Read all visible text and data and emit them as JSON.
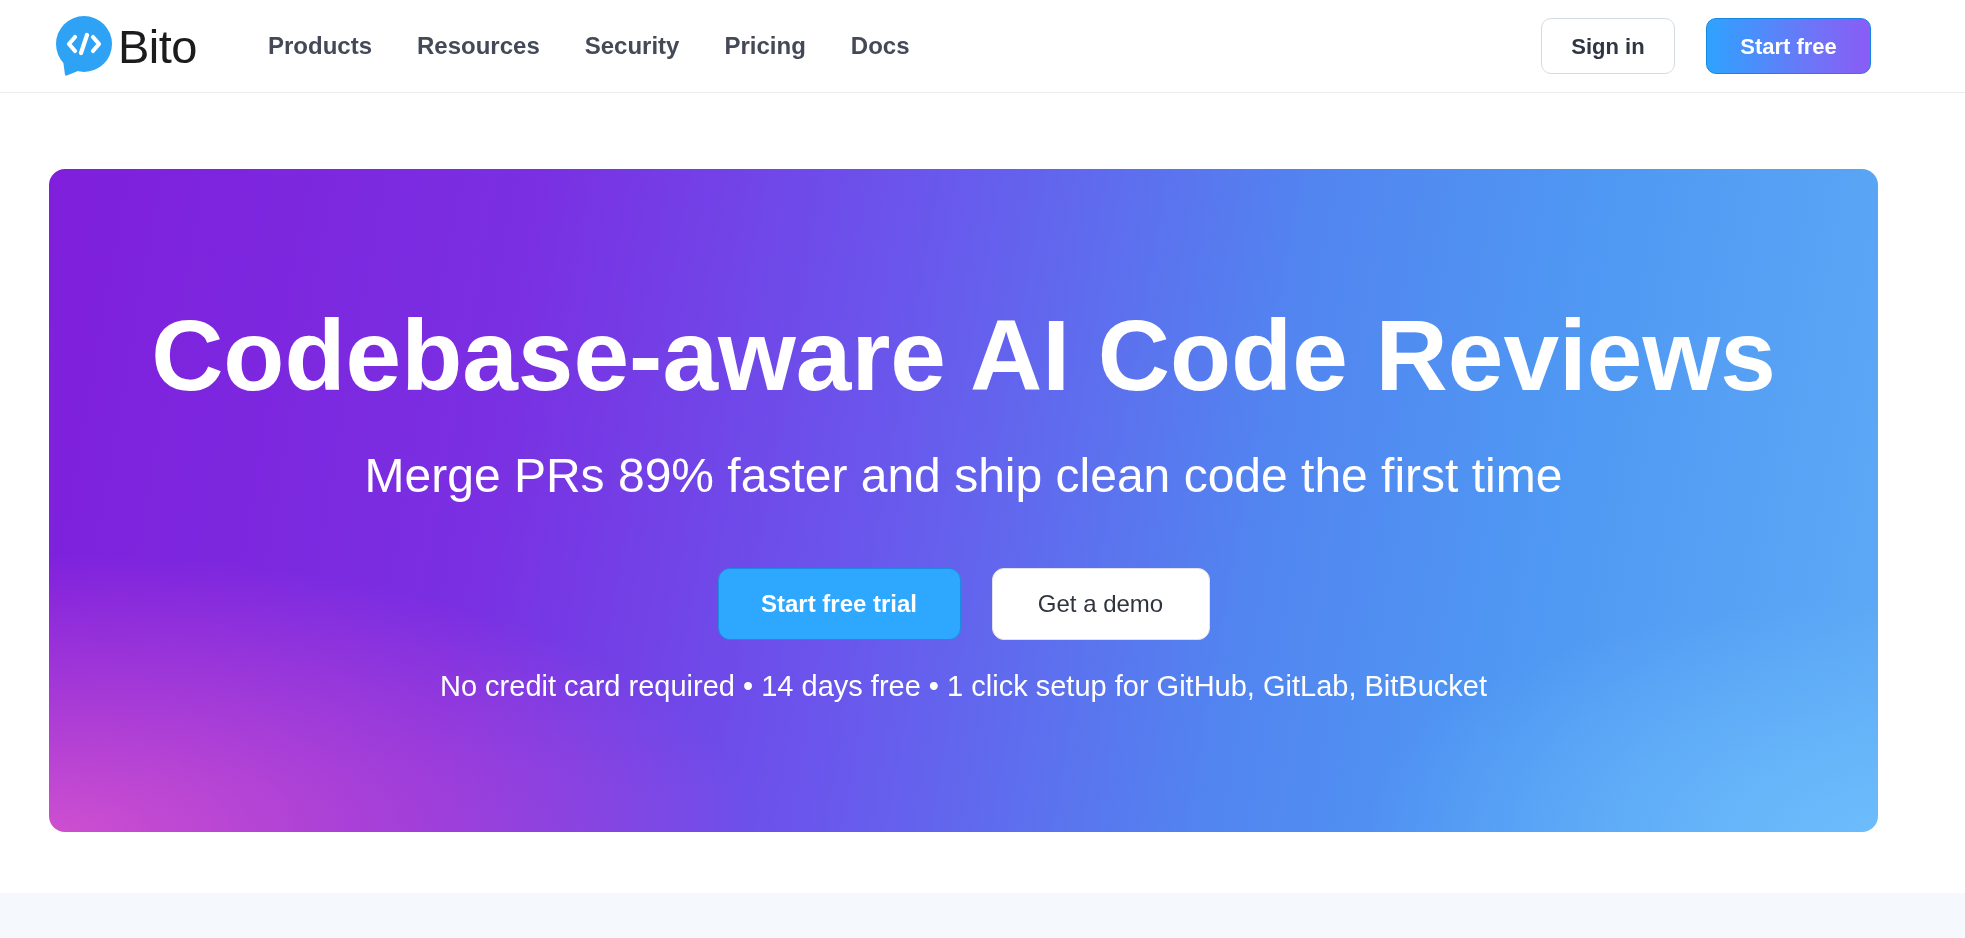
{
  "nav": {
    "logo_text": "Bito",
    "links": [
      "Products",
      "Resources",
      "Security",
      "Pricing",
      "Docs"
    ],
    "buttons": [
      {
        "label": "Sign in",
        "kind": "outline"
      },
      {
        "label": "Start free",
        "kind": "gradient"
      }
    ]
  },
  "hero": {
    "title": "Codebase-aware AI Code Reviews",
    "subtitle": "Merge PRs 89% faster and ship clean code the first time",
    "buttons": [
      {
        "label": "Start free trial",
        "kind": "primary"
      },
      {
        "label": "Get a demo",
        "kind": "secondary"
      }
    ],
    "note": "No credit card required • 14 days free • 1 click setup for GitHub, GitLab, BitBucket"
  }
}
